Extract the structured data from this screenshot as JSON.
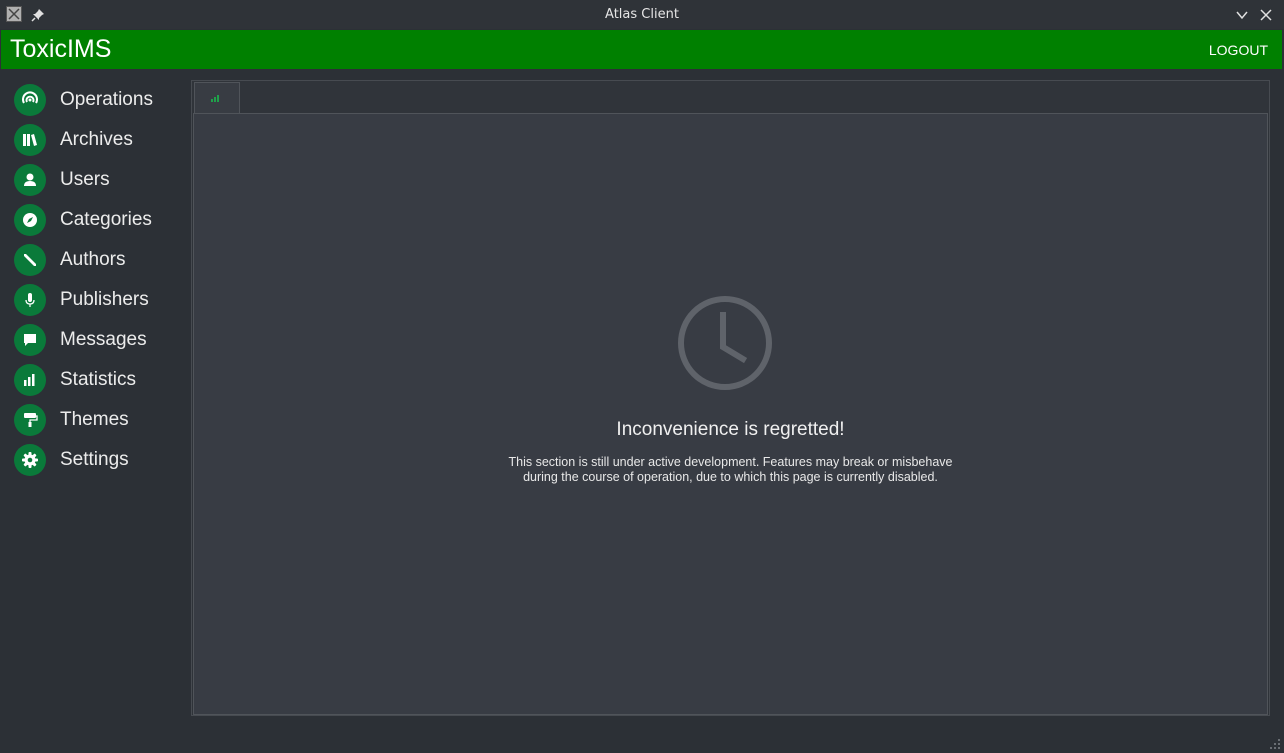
{
  "window": {
    "title": "Atlas Client"
  },
  "header": {
    "brand": "ToxicIMS",
    "logout_label": "LOGOUT",
    "color": "#008000"
  },
  "sidebar": {
    "accent": "#0a7a3a",
    "items": [
      {
        "label": "Operations",
        "icon": "radar-icon"
      },
      {
        "label": "Archives",
        "icon": "books-icon"
      },
      {
        "label": "Users",
        "icon": "user-icon"
      },
      {
        "label": "Categories",
        "icon": "compass-icon"
      },
      {
        "label": "Authors",
        "icon": "pencil-icon"
      },
      {
        "label": "Publishers",
        "icon": "microphone-icon"
      },
      {
        "label": "Messages",
        "icon": "chat-icon"
      },
      {
        "label": "Statistics",
        "icon": "bar-chart-icon"
      },
      {
        "label": "Themes",
        "icon": "paint-roller-icon"
      },
      {
        "label": "Settings",
        "icon": "gear-icon"
      }
    ]
  },
  "main": {
    "tabs": [
      {
        "icon": "bar-chart-icon"
      }
    ],
    "notice": {
      "icon": "clock-icon",
      "title": "Inconvenience is regretted!",
      "line1": "This section is still under active development. Features may break or misbehave",
      "line2": "during the course of operation, due to which this page is currently disabled."
    }
  }
}
